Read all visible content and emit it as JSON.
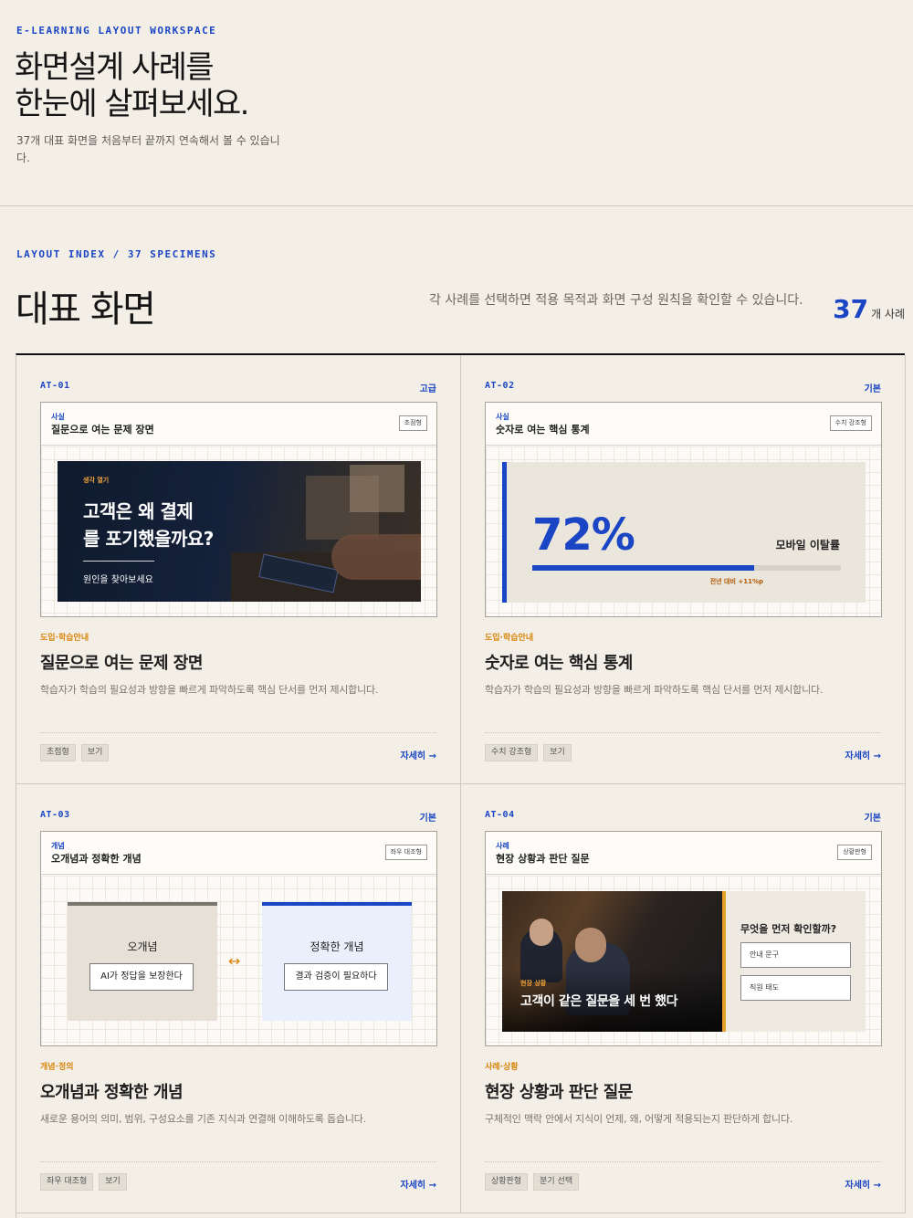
{
  "hero": {
    "eyebrow": "E-LEARNING LAYOUT WORKSPACE",
    "title_line1": "화면설계 사례를",
    "title_line2": "한눈에 살펴보세요.",
    "intro": "37개 대표 화면을 처음부터 끝까지 연속해서 볼 수 있습니다."
  },
  "section": {
    "eyebrow": "LAYOUT INDEX / 37 SPECIMENS",
    "title": "대표 화면",
    "description": "각 사례를 선택하면 적용 목적과 화면 구성 원칙을 확인할 수 있습니다.",
    "count_number": "37",
    "count_unit": "개 사례"
  },
  "colors": {
    "accent": "#1a45c4",
    "highlight": "#d9860c",
    "background": "#f3efe7"
  },
  "cards": [
    {
      "code": "AT-01",
      "level": "고급",
      "preview": {
        "category": "사실",
        "title": "질문으로 여는 문제 장면",
        "tag": "초점형",
        "eyebrow": "생각 열기",
        "headline_line1": "고객은 왜 결제",
        "headline_line2": "를 포기했을까요?",
        "sub": "원인을 찾아보세요"
      },
      "category": "도입·학습안내",
      "title": "질문으로 여는 문제 장면",
      "description": "학습자가 학습의 필요성과 방향을 빠르게 파악하도록 핵심 단서를 먼저 제시합니다.",
      "tags": [
        "초점형",
        "보기"
      ],
      "more": "자세히 →"
    },
    {
      "code": "AT-02",
      "level": "기본",
      "preview": {
        "category": "사실",
        "title": "숫자로 여는 핵심 통계",
        "tag": "수치 강조형",
        "stat_value": "72%",
        "stat_label": "모바일 이탈률",
        "stat_note": "전년 대비 +11%p",
        "progress": 0.72
      },
      "category": "도입·학습안내",
      "title": "숫자로 여는 핵심 통계",
      "description": "학습자가 학습의 필요성과 방향을 빠르게 파악하도록 핵심 단서를 먼저 제시합니다.",
      "tags": [
        "수치 강조형",
        "보기"
      ],
      "more": "자세히 →"
    },
    {
      "code": "AT-03",
      "level": "기본",
      "preview": {
        "category": "개념",
        "title": "오개념과 정확한 개념",
        "tag": "좌우 대조형",
        "left_label": "오개념",
        "left_text": "AI가 정답을 보장한다",
        "right_label": "정확한 개념",
        "right_text": "결과 검증이 필요하다",
        "arrow": "↔"
      },
      "category": "개념·정의",
      "title": "오개념과 정확한 개념",
      "description": "새로운 용어의 의미, 범위, 구성요소를 기존 지식과 연결해 이해하도록 돕습니다.",
      "tags": [
        "좌우 대조형",
        "보기"
      ],
      "more": "자세히 →"
    },
    {
      "code": "AT-04",
      "level": "기본",
      "preview": {
        "category": "사례",
        "title": "현장 상황과 판단 질문",
        "tag": "상황판형",
        "eyebrow": "현장 상황",
        "headline": "고객이 같은 질문을 세 번 했다",
        "question": "무엇을 먼저 확인할까?",
        "field1": "안내 문구",
        "field2": "직원 태도"
      },
      "category": "사례·상황",
      "title": "현장 상황과 판단 질문",
      "description": "구체적인 맥락 안에서 지식이 언제, 왜, 어떻게 적용되는지 판단하게 합니다.",
      "tags": [
        "상황판형",
        "분기 선택"
      ],
      "more": "자세히 →"
    }
  ]
}
